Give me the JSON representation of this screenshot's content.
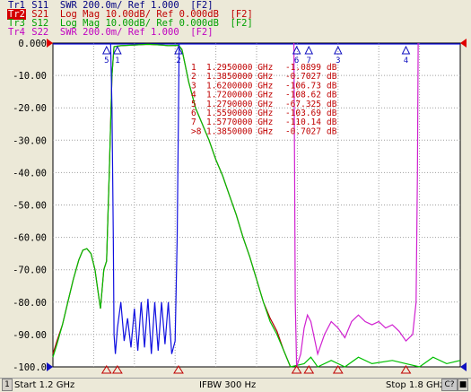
{
  "traces": [
    {
      "tag": "Tr1",
      "text": "S11  SWR 200.0m/ Ref 1.000  [F2]",
      "color": "#000080",
      "active": false
    },
    {
      "tag": "Tr2",
      "text": "S21  Log Mag 10.00dB/ Ref 0.000dB  [F2]",
      "color": "#c00000",
      "active": true
    },
    {
      "tag": "Tr3",
      "text": "S12  Log Mag 10.00dB/ Ref 0.000dB  [F2]",
      "color": "#00a000",
      "active": false
    },
    {
      "tag": "Tr4",
      "text": "S22  SWR 200.0m/ Ref 1.000  [F2]",
      "color": "#c000c0",
      "active": false
    }
  ],
  "chart_data": {
    "type": "line",
    "x_unit": "GHz",
    "xlim": [
      1.2,
      1.8
    ],
    "ylim": [
      -100,
      0
    ],
    "y_ticks": [
      "0.000",
      "-10.00",
      "-20.00",
      "-30.00",
      "-40.00",
      "-50.00",
      "-60.00",
      "-70.00",
      "-80.00",
      "-90.00",
      "-100.0"
    ],
    "grid": true,
    "colors": {
      "s11": "#1010e0",
      "s21": "#b00000",
      "s12": "#00c000",
      "s22": "#d020d0",
      "marker": "#c00000",
      "ref_marker": "#e00000"
    },
    "series": [
      {
        "key": "s21",
        "values": [
          [
            1.2,
            -96
          ],
          [
            1.206,
            -92
          ],
          [
            1.214,
            -87
          ],
          [
            1.222,
            -80
          ],
          [
            1.23,
            -73
          ],
          [
            1.238,
            -67
          ],
          [
            1.244,
            -64
          ],
          [
            1.25,
            -63.5
          ],
          [
            1.256,
            -65
          ],
          [
            1.262,
            -70
          ],
          [
            1.266,
            -76
          ],
          [
            1.27,
            -82
          ],
          [
            1.275,
            -70
          ],
          [
            1.279,
            -67.3
          ],
          [
            1.283,
            -40
          ],
          [
            1.287,
            -10
          ],
          [
            1.29,
            -1.1
          ],
          [
            1.3,
            -0.8
          ],
          [
            1.32,
            -0.6
          ],
          [
            1.34,
            -0.4
          ],
          [
            1.36,
            -0.6
          ],
          [
            1.37,
            -0.8
          ],
          [
            1.385,
            -0.7
          ],
          [
            1.39,
            -2
          ],
          [
            1.395,
            -7
          ],
          [
            1.4,
            -12
          ],
          [
            1.41,
            -20
          ],
          [
            1.42,
            -25
          ],
          [
            1.43,
            -30
          ],
          [
            1.44,
            -36
          ],
          [
            1.45,
            -41
          ],
          [
            1.46,
            -47
          ],
          [
            1.47,
            -53
          ],
          [
            1.48,
            -60
          ],
          [
            1.49,
            -66
          ],
          [
            1.5,
            -73
          ],
          [
            1.51,
            -80
          ],
          [
            1.52,
            -85
          ],
          [
            1.53,
            -89
          ],
          [
            1.54,
            -95
          ],
          [
            1.55,
            -100
          ]
        ]
      },
      {
        "key": "s12",
        "values": [
          [
            1.2,
            -97
          ],
          [
            1.206,
            -93
          ],
          [
            1.214,
            -87
          ],
          [
            1.222,
            -80
          ],
          [
            1.23,
            -73
          ],
          [
            1.238,
            -67
          ],
          [
            1.244,
            -64
          ],
          [
            1.25,
            -63.5
          ],
          [
            1.256,
            -65
          ],
          [
            1.262,
            -70
          ],
          [
            1.266,
            -76
          ],
          [
            1.27,
            -82
          ],
          [
            1.275,
            -70
          ],
          [
            1.279,
            -67.3
          ],
          [
            1.283,
            -40
          ],
          [
            1.287,
            -10
          ],
          [
            1.29,
            -1.1
          ],
          [
            1.3,
            -0.8
          ],
          [
            1.32,
            -0.6
          ],
          [
            1.34,
            -0.4
          ],
          [
            1.36,
            -0.6
          ],
          [
            1.37,
            -0.8
          ],
          [
            1.385,
            -0.7
          ],
          [
            1.39,
            -2
          ],
          [
            1.395,
            -7
          ],
          [
            1.4,
            -12
          ],
          [
            1.41,
            -20
          ],
          [
            1.42,
            -25
          ],
          [
            1.43,
            -30
          ],
          [
            1.44,
            -36
          ],
          [
            1.45,
            -41
          ],
          [
            1.46,
            -47
          ],
          [
            1.47,
            -53
          ],
          [
            1.48,
            -60
          ],
          [
            1.49,
            -66
          ],
          [
            1.5,
            -73
          ],
          [
            1.51,
            -80
          ],
          [
            1.52,
            -86
          ],
          [
            1.53,
            -90
          ],
          [
            1.54,
            -95
          ],
          [
            1.55,
            -100
          ],
          [
            1.57,
            -99
          ],
          [
            1.58,
            -97
          ],
          [
            1.59,
            -100
          ],
          [
            1.61,
            -98
          ],
          [
            1.63,
            -100
          ],
          [
            1.65,
            -97
          ],
          [
            1.67,
            -99
          ],
          [
            1.7,
            -98
          ],
          [
            1.72,
            -99
          ],
          [
            1.74,
            -100
          ],
          [
            1.76,
            -97
          ],
          [
            1.78,
            -99
          ],
          [
            1.8,
            -98
          ]
        ]
      },
      {
        "key": "s11",
        "values": [
          [
            1.285,
            0
          ],
          [
            1.287,
            -20
          ],
          [
            1.289,
            -60
          ],
          [
            1.29,
            -90
          ],
          [
            1.292,
            -96
          ],
          [
            1.295,
            -88
          ],
          [
            1.3,
            -80
          ],
          [
            1.305,
            -92
          ],
          [
            1.31,
            -85
          ],
          [
            1.315,
            -94
          ],
          [
            1.32,
            -82
          ],
          [
            1.325,
            -95
          ],
          [
            1.33,
            -80
          ],
          [
            1.335,
            -94
          ],
          [
            1.34,
            -79
          ],
          [
            1.345,
            -96
          ],
          [
            1.35,
            -80
          ],
          [
            1.355,
            -95
          ],
          [
            1.36,
            -80
          ],
          [
            1.365,
            -93
          ],
          [
            1.37,
            -80
          ],
          [
            1.375,
            -96
          ],
          [
            1.38,
            -92
          ],
          [
            1.383,
            -60
          ],
          [
            1.385,
            -20
          ],
          [
            1.386,
            0
          ]
        ]
      },
      {
        "key": "s22",
        "values": [
          [
            1.555,
            0
          ],
          [
            1.556,
            -40
          ],
          [
            1.557,
            -80
          ],
          [
            1.558,
            -90
          ],
          [
            1.559,
            -103
          ],
          [
            1.565,
            -96
          ],
          [
            1.57,
            -88
          ],
          [
            1.575,
            -84
          ],
          [
            1.58,
            -86
          ],
          [
            1.59,
            -96
          ],
          [
            1.6,
            -90
          ],
          [
            1.61,
            -86
          ],
          [
            1.62,
            -88
          ],
          [
            1.63,
            -91
          ],
          [
            1.64,
            -86
          ],
          [
            1.65,
            -84
          ],
          [
            1.66,
            -86
          ],
          [
            1.67,
            -87
          ],
          [
            1.68,
            -86
          ],
          [
            1.69,
            -88
          ],
          [
            1.7,
            -87
          ],
          [
            1.71,
            -89
          ],
          [
            1.72,
            -92
          ],
          [
            1.73,
            -90
          ],
          [
            1.735,
            -80
          ],
          [
            1.737,
            -40
          ],
          [
            1.738,
            0
          ]
        ]
      }
    ],
    "markers": [
      {
        "label": "1",
        "x": 1.295,
        "y": -1.0899
      },
      {
        "label": "2",
        "x": 1.385,
        "y": -0.7027
      },
      {
        "label": "3",
        "x": 1.62,
        "y": -106.73
      },
      {
        "label": "4",
        "x": 1.72,
        "y": -108.62
      },
      {
        "label": "5",
        "x": 1.279,
        "y": -67.325
      },
      {
        "label": "6",
        "x": 1.559,
        "y": -103.69
      },
      {
        "label": "7",
        "x": 1.577,
        "y": -110.14
      },
      {
        "label": "8",
        "x": 1.385,
        "y": -0.7027
      }
    ],
    "marker_table": [
      {
        "num": "1",
        "freq": "1.2950000 GHz",
        "val": "-1.0899",
        "unit": "dB"
      },
      {
        "num": "2",
        "freq": "1.3850000 GHz",
        "val": "-0.7027",
        "unit": "dB"
      },
      {
        "num": "3",
        "freq": "1.6200000 GHz",
        "val": "-106.73",
        "unit": "dB"
      },
      {
        "num": "4",
        "freq": "1.7200000 GHz",
        "val": "-108.62",
        "unit": "dB"
      },
      {
        "num": "5",
        "freq": "1.2790000 GHz",
        "val": "-67.325",
        "unit": "dB"
      },
      {
        "num": "6",
        "freq": "1.5590000 GHz",
        "val": "-103.69",
        "unit": "dB"
      },
      {
        "num": "7",
        "freq": "1.5770000 GHz",
        "val": "-110.14",
        "unit": "dB"
      },
      {
        "num": ">8",
        "freq": "1.3850000 GHz",
        "val": "-0.7027",
        "unit": "dB"
      }
    ]
  },
  "status": {
    "channel": "1",
    "start": "Start 1.2 GHz",
    "ifbw": "IFBW 300 Hz",
    "stop": "Stop 1.8 GHz",
    "cal": "C?"
  }
}
